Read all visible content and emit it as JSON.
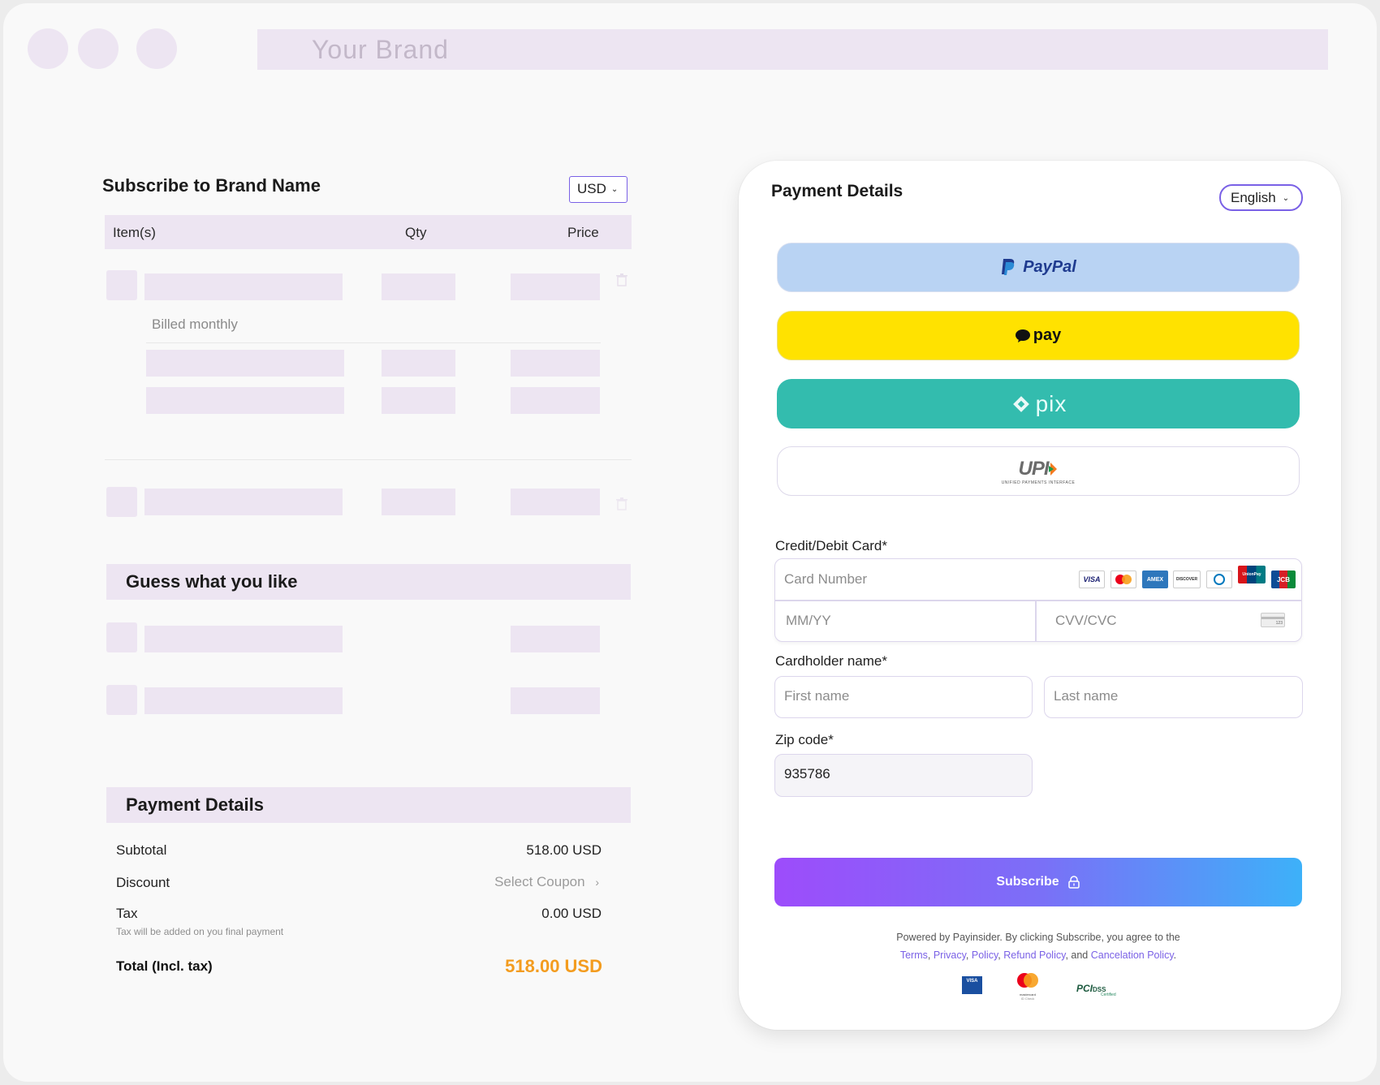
{
  "browser": {
    "address": "Your Brand"
  },
  "order": {
    "title": "Subscribe to Brand Name",
    "currency": "USD",
    "columns": {
      "items": "Item(s)",
      "qty": "Qty",
      "price": "Price"
    },
    "billing_note": "Billed monthly"
  },
  "recommendations": {
    "title": "Guess what you like"
  },
  "summary": {
    "title": "Payment Details",
    "subtotal_label": "Subtotal",
    "subtotal_value": "518.00 USD",
    "discount_label": "Discount",
    "discount_action": "Select Coupon",
    "tax_label": "Tax",
    "tax_value": "0.00 USD",
    "tax_note": "Tax will be added on you final payment",
    "total_label": "Total (Incl. tax)",
    "total_value": "518.00 USD",
    "total_color": "#f39c1f"
  },
  "payment": {
    "title": "Payment Details",
    "language": "English",
    "methods": {
      "paypal": "PayPal",
      "kakaopay": "pay",
      "pix": "pix",
      "upi": "UPI",
      "upi_tagline": "UNIFIED PAYMENTS INTERFACE"
    },
    "card_label": "Credit/Debit Card*",
    "card_number_placeholder": "Card Number",
    "card_brands": [
      "VISA",
      "AMEX",
      "DISCOVER",
      "UnionPay",
      "JCB"
    ],
    "expiry_placeholder": "MM/YY",
    "cvv_placeholder": "CVV/CVC",
    "cvv_icon_text": "123",
    "holder_label": "Cardholder name*",
    "first_name_placeholder": "First name",
    "last_name_placeholder": "Last name",
    "zip_label": "Zip code*",
    "zip_value": "935786",
    "subscribe_label": "Subscribe",
    "legal_prefix": "Powered by Payinsider. By clicking Subscribe, you agree to the",
    "legal_terms": "Terms",
    "legal_privacy": "Privacy",
    "legal_policy": "Policy",
    "legal_refund": "Refund Policy",
    "legal_and": "and",
    "legal_cancel": "Cancelation Policy",
    "badges": {
      "visa": "VISA",
      "mastercard": "mastercard",
      "mastercard_sub": "ID Check",
      "pci": "PCI",
      "dss": "DSS",
      "dss_sub": "Certified"
    },
    "accent_color": "#7a61e6"
  }
}
